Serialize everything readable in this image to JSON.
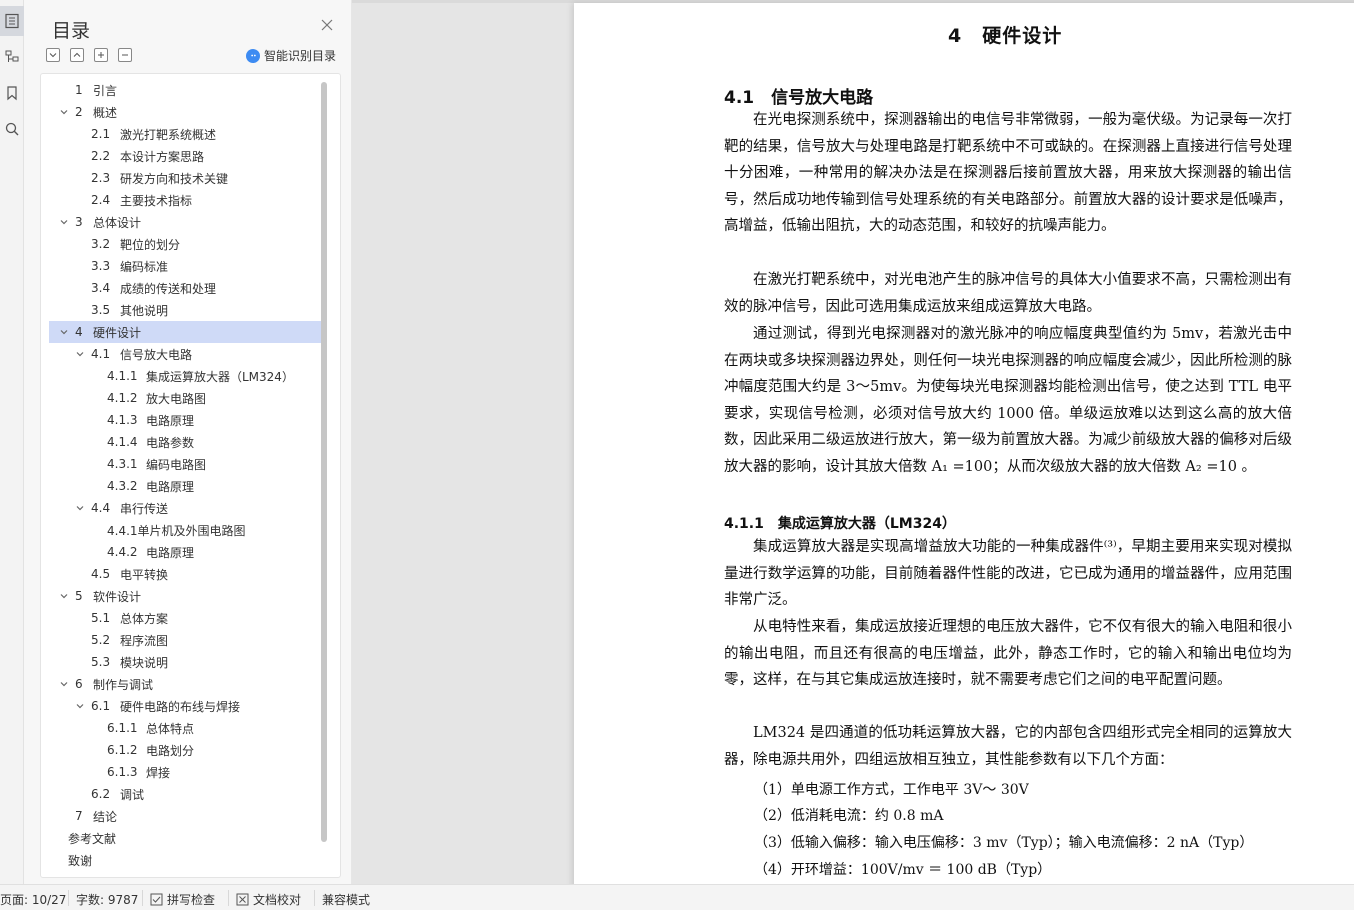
{
  "toc_panel": {
    "title": "目录",
    "smart_toc_label": "智能识别目录",
    "items": [
      {
        "num": "1",
        "text": "引言"
      },
      {
        "num": "2",
        "text": "概述"
      },
      {
        "num": "2.1",
        "text": "激光打靶系统概述"
      },
      {
        "num": "2.2",
        "text": "本设计方案思路"
      },
      {
        "num": "2.3",
        "text": "研发方向和技术关键"
      },
      {
        "num": "2.4",
        "text": "主要技术指标"
      },
      {
        "num": "3",
        "text": "总体设计"
      },
      {
        "num": "3.2",
        "text": "靶位的划分"
      },
      {
        "num": "3.3",
        "text": " 编码标准"
      },
      {
        "num": "3.4",
        "text": "成绩的传送和处理"
      },
      {
        "num": "3.5",
        "text": "其他说明"
      },
      {
        "num": "4",
        "text": "硬件设计"
      },
      {
        "num": "4.1",
        "text": "信号放大电路"
      },
      {
        "num": "4.1.1",
        "text": "集成运算放大器（LM324）"
      },
      {
        "num": "4.1.2",
        "text": "放大电路图"
      },
      {
        "num": "4.1.3",
        "text": "电路原理"
      },
      {
        "num": "4.1.4",
        "text": "电路参数"
      },
      {
        "num": "4.3.1",
        "text": "编码电路图"
      },
      {
        "num": "4.3.2",
        "text": "电路原理"
      },
      {
        "num": "4.4",
        "text": "串行传送"
      },
      {
        "num": "",
        "text": "4.4.1单片机及外围电路图"
      },
      {
        "num": "4.4.2",
        "text": "电路原理"
      },
      {
        "num": "4.5",
        "text": "电平转换"
      },
      {
        "num": "5",
        "text": "软件设计"
      },
      {
        "num": "5.1",
        "text": "总体方案"
      },
      {
        "num": "5.2",
        "text": "程序流图"
      },
      {
        "num": "5.3",
        "text": "模块说明"
      },
      {
        "num": "6",
        "text": "制作与调试"
      },
      {
        "num": "6.1",
        "text": "硬件电路的布线与焊接"
      },
      {
        "num": "6.1.1",
        "text": "总体特点"
      },
      {
        "num": "6.1.2",
        "text": "电路划分"
      },
      {
        "num": "6.1.3",
        "text": "焊接"
      },
      {
        "num": "6.2",
        "text": "调试"
      },
      {
        "num": "7",
        "text": "结论"
      },
      {
        "num": "",
        "text": "参考文献"
      },
      {
        "num": "",
        "text": "致谢"
      }
    ]
  },
  "document": {
    "chapter_title": "4　硬件设计",
    "section_title": "4.1　信号放大电路",
    "paragraphs": [
      "在光电探测系统中，探测器输出的电信号非常微弱，一般为毫伏级。为记录每一次打靶的结果，信号放大与处理电路是打靶系统中不可或缺的。在探测器上直接进行信号处理十分困难，一种常用的解决办法是在探测器后接前置放大器，用来放大探测器的输出信号，然后成功地传输到信号处理系统的有关电路部分。前置放大器的设计要求是低噪声，高增益，低输出阻抗，大的动态范围，和较好的抗噪声能力。",
      "在激光打靶系统中，对光电池产生的脉冲信号的具体大小值要求不高，只需检测出有效的脉冲信号，因此可选用集成运放来组成运算放大电路。",
      "通过测试，得到光电探测器对的激光脉冲的响应幅度典型值约为 5mv，若激光击中在两块或多块探测器边界处，则任何一块光电探测器的响应幅度会减少，因此所检测的脉冲幅度范围大约是 3～5mv。为使每块光电探测器均能检测出信号，使之达到 TTL 电平要求，实现信号检测，必须对信号放大约 1000 倍。单级运放难以达到这么高的放大倍数，因此采用二级运放进行放大，第一级为前置放大器。为减少前级放大器的偏移对后级放大器的影响，设计其放大倍数 A₁ =100；从而次级放大器的放大倍数 A₂ =10 。"
    ],
    "subsection_title": "4.1.1　集成运算放大器（LM324）",
    "paragraphs2": [
      "集成运算放大器是实现高增益放大功能的一种集成器件⁽³⁾，早期主要用来实现对模拟量进行数学运算的功能，目前随着器件性能的改进，它已成为通用的增益器件，应用范围非常广泛。",
      "从电特性来看，集成运放接近理想的电压放大器件，它不仅有很大的输入电阻和很小的输出电阻，而且还有很高的电压增益，此外，静态工作时，它的输入和输出电位均为零，这样，在与其它集成运放连接时，就不需要考虑它们之间的电平配置问题。",
      "LM324 是四通道的低功耗运算放大器，它的内部包含四组形式完全相同的运算放大器，除电源共用外，四组运放相互独立，其性能参数有以下几个方面："
    ],
    "list_items": [
      "（1）单电源工作方式，工作电平 3V～ 30V",
      "（2）低消耗电流：约 0.8 mA",
      "（3）低输入偏移：输入电压偏移：3 mv（Typ）；输入电流偏移：2 nA（Typ）",
      "（4）开环增益：100V/mv ＝ 100 dB（Typ）"
    ]
  },
  "status_bar": {
    "page": "页面: 10/27",
    "word_count": "字数: 9787",
    "spell_check": "拼写检查",
    "doc_proof": "文档校对",
    "compat_mode": "兼容模式"
  }
}
